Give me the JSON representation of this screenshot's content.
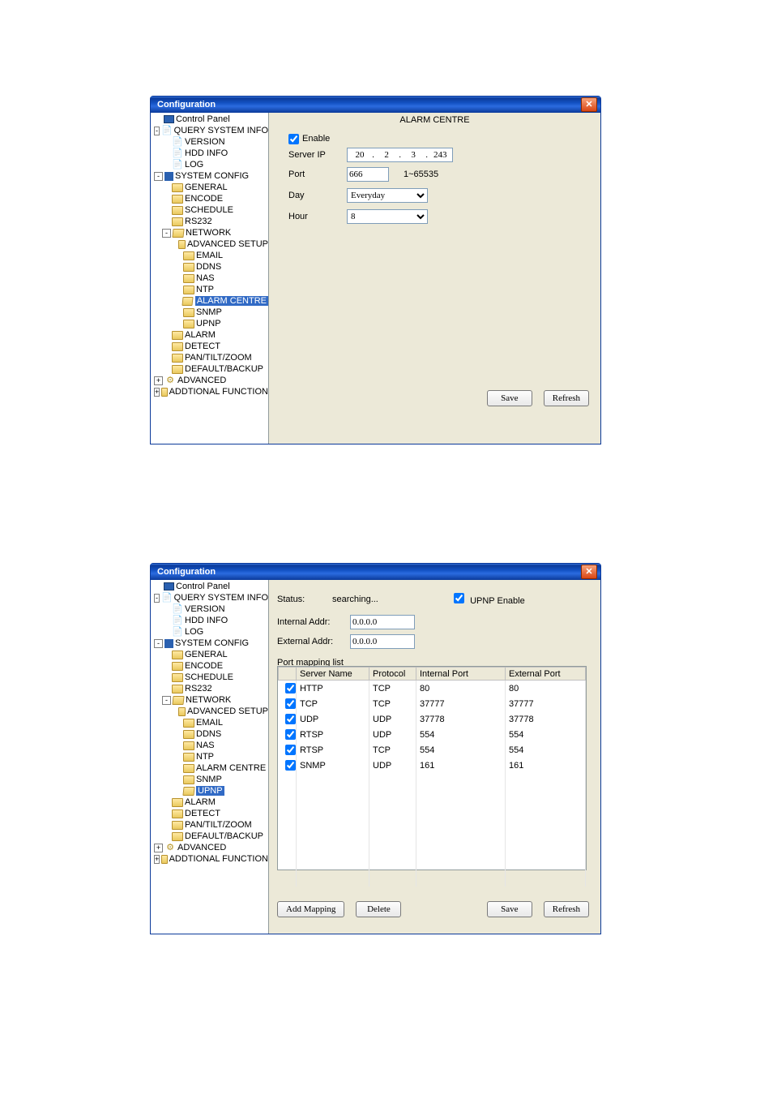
{
  "win1": {
    "title": "Configuration",
    "tree": [
      {
        "lvl": 0,
        "exp": "",
        "icon": "panel",
        "label": "Control Panel"
      },
      {
        "lvl": 0,
        "exp": "-",
        "icon": "doc",
        "label": "QUERY SYSTEM INFO"
      },
      {
        "lvl": 1,
        "exp": "",
        "icon": "doc",
        "label": "VERSION"
      },
      {
        "lvl": 1,
        "exp": "",
        "icon": "doc",
        "label": "HDD INFO"
      },
      {
        "lvl": 1,
        "exp": "",
        "icon": "doc",
        "label": "LOG"
      },
      {
        "lvl": 0,
        "exp": "-",
        "icon": "sysc",
        "label": "SYSTEM CONFIG"
      },
      {
        "lvl": 1,
        "exp": "",
        "icon": "folder",
        "label": "GENERAL"
      },
      {
        "lvl": 1,
        "exp": "",
        "icon": "folder",
        "label": "ENCODE"
      },
      {
        "lvl": 1,
        "exp": "",
        "icon": "folder",
        "label": "SCHEDULE"
      },
      {
        "lvl": 1,
        "exp": "",
        "icon": "folder",
        "label": "RS232"
      },
      {
        "lvl": 1,
        "exp": "-",
        "icon": "folderO",
        "label": "NETWORK"
      },
      {
        "lvl": 2,
        "exp": "",
        "icon": "folder",
        "label": "ADVANCED SETUP"
      },
      {
        "lvl": 2,
        "exp": "",
        "icon": "folder",
        "label": "EMAIL"
      },
      {
        "lvl": 2,
        "exp": "",
        "icon": "folder",
        "label": "DDNS"
      },
      {
        "lvl": 2,
        "exp": "",
        "icon": "folder",
        "label": "NAS"
      },
      {
        "lvl": 2,
        "exp": "",
        "icon": "folder",
        "label": "NTP"
      },
      {
        "lvl": 2,
        "exp": "",
        "icon": "folderO",
        "label": "ALARM CENTRE",
        "sel": true
      },
      {
        "lvl": 2,
        "exp": "",
        "icon": "folder",
        "label": "SNMP"
      },
      {
        "lvl": 2,
        "exp": "",
        "icon": "folder",
        "label": "UPNP"
      },
      {
        "lvl": 1,
        "exp": "",
        "icon": "folder",
        "label": "ALARM"
      },
      {
        "lvl": 1,
        "exp": "",
        "icon": "folder",
        "label": "DETECT"
      },
      {
        "lvl": 1,
        "exp": "",
        "icon": "folder",
        "label": "PAN/TILT/ZOOM"
      },
      {
        "lvl": 1,
        "exp": "",
        "icon": "folder",
        "label": "DEFAULT/BACKUP"
      },
      {
        "lvl": 0,
        "exp": "+",
        "icon": "gear",
        "label": "ADVANCED"
      },
      {
        "lvl": 0,
        "exp": "+",
        "icon": "folder",
        "label": "ADDTIONAL FUNCTION"
      }
    ],
    "pane": {
      "header": "ALARM CENTRE",
      "enable_label": "Enable",
      "server_ip_label": "Server IP",
      "ip": [
        "20",
        "2",
        "3",
        "243"
      ],
      "port_label": "Port",
      "port_value": "666",
      "port_range": "1~65535",
      "day_label": "Day",
      "day_value": "Everyday",
      "hour_label": "Hour",
      "hour_value": "8",
      "save": "Save",
      "refresh": "Refresh"
    }
  },
  "win2": {
    "title": "Configuration",
    "tree": [
      {
        "lvl": 0,
        "exp": "",
        "icon": "panel",
        "label": "Control Panel"
      },
      {
        "lvl": 0,
        "exp": "-",
        "icon": "doc",
        "label": "QUERY SYSTEM INFO"
      },
      {
        "lvl": 1,
        "exp": "",
        "icon": "doc",
        "label": "VERSION"
      },
      {
        "lvl": 1,
        "exp": "",
        "icon": "doc",
        "label": "HDD INFO"
      },
      {
        "lvl": 1,
        "exp": "",
        "icon": "doc",
        "label": "LOG"
      },
      {
        "lvl": 0,
        "exp": "-",
        "icon": "sysc",
        "label": "SYSTEM CONFIG"
      },
      {
        "lvl": 1,
        "exp": "",
        "icon": "folder",
        "label": "GENERAL"
      },
      {
        "lvl": 1,
        "exp": "",
        "icon": "folder",
        "label": "ENCODE"
      },
      {
        "lvl": 1,
        "exp": "",
        "icon": "folder",
        "label": "SCHEDULE"
      },
      {
        "lvl": 1,
        "exp": "",
        "icon": "folder",
        "label": "RS232"
      },
      {
        "lvl": 1,
        "exp": "-",
        "icon": "folderO",
        "label": "NETWORK"
      },
      {
        "lvl": 2,
        "exp": "",
        "icon": "folder",
        "label": "ADVANCED SETUP"
      },
      {
        "lvl": 2,
        "exp": "",
        "icon": "folder",
        "label": "EMAIL"
      },
      {
        "lvl": 2,
        "exp": "",
        "icon": "folder",
        "label": "DDNS"
      },
      {
        "lvl": 2,
        "exp": "",
        "icon": "folder",
        "label": "NAS"
      },
      {
        "lvl": 2,
        "exp": "",
        "icon": "folder",
        "label": "NTP"
      },
      {
        "lvl": 2,
        "exp": "",
        "icon": "folder",
        "label": "ALARM CENTRE"
      },
      {
        "lvl": 2,
        "exp": "",
        "icon": "folder",
        "label": "SNMP"
      },
      {
        "lvl": 2,
        "exp": "",
        "icon": "folderO",
        "label": "UPNP",
        "sel": true
      },
      {
        "lvl": 1,
        "exp": "",
        "icon": "folder",
        "label": "ALARM"
      },
      {
        "lvl": 1,
        "exp": "",
        "icon": "folder",
        "label": "DETECT"
      },
      {
        "lvl": 1,
        "exp": "",
        "icon": "folder",
        "label": "PAN/TILT/ZOOM"
      },
      {
        "lvl": 1,
        "exp": "",
        "icon": "folder",
        "label": "DEFAULT/BACKUP"
      },
      {
        "lvl": 0,
        "exp": "+",
        "icon": "gear",
        "label": "ADVANCED"
      },
      {
        "lvl": 0,
        "exp": "+",
        "icon": "folder",
        "label": "ADDTIONAL FUNCTION"
      }
    ],
    "pane": {
      "status_label": "Status:",
      "status_value": "searching...",
      "upnp_label": "UPNP Enable",
      "internal_label": "Internal Addr:",
      "internal_value": "0.0.0.0",
      "external_label": "External Addr:",
      "external_value": "0.0.0.0",
      "listlabel": "Port mapping list",
      "cols": [
        "",
        "Server Name",
        "Protocol",
        "Internal Port",
        "External Port"
      ],
      "rows": [
        {
          "chk": true,
          "name": "HTTP",
          "proto": "TCP",
          "in": "80",
          "out": "80"
        },
        {
          "chk": true,
          "name": "TCP",
          "proto": "TCP",
          "in": "37777",
          "out": "37777"
        },
        {
          "chk": true,
          "name": "UDP",
          "proto": "UDP",
          "in": "37778",
          "out": "37778"
        },
        {
          "chk": true,
          "name": "RTSP",
          "proto": "UDP",
          "in": "554",
          "out": "554"
        },
        {
          "chk": true,
          "name": "RTSP",
          "proto": "TCP",
          "in": "554",
          "out": "554"
        },
        {
          "chk": true,
          "name": "SNMP",
          "proto": "UDP",
          "in": "161",
          "out": "161"
        }
      ],
      "add": "Add Mapping",
      "delete": "Delete",
      "save": "Save",
      "refresh": "Refresh"
    }
  }
}
